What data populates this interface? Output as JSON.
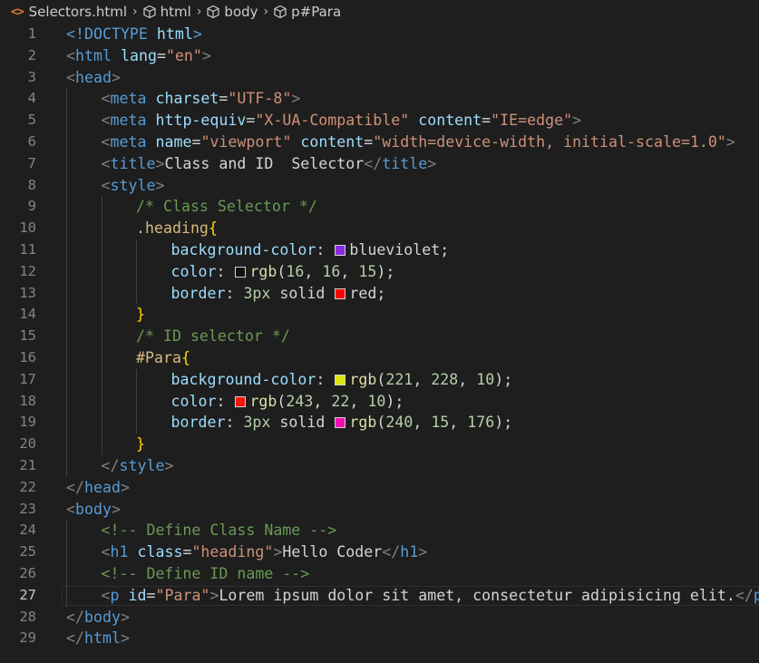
{
  "breadcrumb": {
    "file_icon": "<>",
    "file": "Selectors.html",
    "items": [
      "html",
      "body",
      "p#Para"
    ]
  },
  "editor": {
    "active_line": 27,
    "line_numbers": [
      "1",
      "2",
      "3",
      "4",
      "5",
      "6",
      "7",
      "8",
      "9",
      "10",
      "11",
      "12",
      "13",
      "14",
      "15",
      "16",
      "17",
      "18",
      "19",
      "20",
      "21",
      "22",
      "23",
      "24",
      "25",
      "26",
      "27",
      "28",
      "29"
    ],
    "lines": [
      {
        "indent": 0,
        "tokens": [
          [
            "t-tag",
            "<!DOCTYPE"
          ],
          [
            "t-text",
            " "
          ],
          [
            "t-attr",
            "html"
          ],
          [
            "t-tag",
            ">"
          ]
        ]
      },
      {
        "indent": 0,
        "tokens": [
          [
            "t-punc",
            "<"
          ],
          [
            "t-tag",
            "html"
          ],
          [
            "t-text",
            " "
          ],
          [
            "t-attr",
            "lang"
          ],
          [
            "t-text",
            "="
          ],
          [
            "t-str",
            "\"en\""
          ],
          [
            "t-punc",
            ">"
          ]
        ]
      },
      {
        "indent": 0,
        "tokens": [
          [
            "t-punc",
            "<"
          ],
          [
            "t-tag",
            "head"
          ],
          [
            "t-punc",
            ">"
          ]
        ]
      },
      {
        "indent": 1,
        "tokens": [
          [
            "t-punc",
            "<"
          ],
          [
            "t-tag",
            "meta"
          ],
          [
            "t-text",
            " "
          ],
          [
            "t-attr",
            "charset"
          ],
          [
            "t-text",
            "="
          ],
          [
            "t-str",
            "\"UTF-8\""
          ],
          [
            "t-punc",
            ">"
          ]
        ]
      },
      {
        "indent": 1,
        "tokens": [
          [
            "t-punc",
            "<"
          ],
          [
            "t-tag",
            "meta"
          ],
          [
            "t-text",
            " "
          ],
          [
            "t-attr",
            "http-equiv"
          ],
          [
            "t-text",
            "="
          ],
          [
            "t-str",
            "\"X-UA-Compatible\""
          ],
          [
            "t-text",
            " "
          ],
          [
            "t-attr",
            "content"
          ],
          [
            "t-text",
            "="
          ],
          [
            "t-str",
            "\"IE=edge\""
          ],
          [
            "t-punc",
            ">"
          ]
        ]
      },
      {
        "indent": 1,
        "tokens": [
          [
            "t-punc",
            "<"
          ],
          [
            "t-tag",
            "meta"
          ],
          [
            "t-text",
            " "
          ],
          [
            "t-attr",
            "name"
          ],
          [
            "t-text",
            "="
          ],
          [
            "t-str",
            "\"viewport\""
          ],
          [
            "t-text",
            " "
          ],
          [
            "t-attr",
            "content"
          ],
          [
            "t-text",
            "="
          ],
          [
            "t-str",
            "\"width=device-width, initial-scale=1.0\""
          ],
          [
            "t-punc",
            ">"
          ]
        ]
      },
      {
        "indent": 1,
        "tokens": [
          [
            "t-punc",
            "<"
          ],
          [
            "t-tag",
            "title"
          ],
          [
            "t-punc",
            ">"
          ],
          [
            "t-text",
            "Class and ID  Selector"
          ],
          [
            "t-punc",
            "</"
          ],
          [
            "t-tag",
            "title"
          ],
          [
            "t-punc",
            ">"
          ]
        ]
      },
      {
        "indent": 1,
        "tokens": [
          [
            "t-punc",
            "<"
          ],
          [
            "t-tag",
            "style"
          ],
          [
            "t-punc",
            ">"
          ]
        ]
      },
      {
        "indent": 2,
        "tokens": [
          [
            "t-comment",
            "/* Class Selector */"
          ]
        ]
      },
      {
        "indent": 2,
        "tokens": [
          [
            "t-sel",
            ".heading"
          ],
          [
            "t-brace",
            "{"
          ]
        ]
      },
      {
        "indent": 3,
        "tokens": [
          [
            "t-prop",
            "background-color"
          ],
          [
            "t-text",
            ": "
          ],
          [
            "swatch",
            "#8a2be2"
          ],
          [
            "t-text",
            "blueviolet;"
          ]
        ]
      },
      {
        "indent": 3,
        "tokens": [
          [
            "t-prop",
            "color"
          ],
          [
            "t-text",
            ": "
          ],
          [
            "swatch",
            "#10100f"
          ],
          [
            "t-fn",
            "rgb"
          ],
          [
            "t-text",
            "("
          ],
          [
            "t-num",
            "16"
          ],
          [
            "t-text",
            ", "
          ],
          [
            "t-num",
            "16"
          ],
          [
            "t-text",
            ", "
          ],
          [
            "t-num",
            "15"
          ],
          [
            "t-text",
            ");"
          ]
        ]
      },
      {
        "indent": 3,
        "tokens": [
          [
            "t-prop",
            "border"
          ],
          [
            "t-text",
            ": "
          ],
          [
            "t-num",
            "3px"
          ],
          [
            "t-text",
            " solid "
          ],
          [
            "swatch",
            "#ff0000"
          ],
          [
            "t-text",
            "red;"
          ]
        ]
      },
      {
        "indent": 2,
        "tokens": [
          [
            "t-brace",
            "}"
          ]
        ]
      },
      {
        "indent": 2,
        "tokens": [
          [
            "t-comment",
            "/* ID selector */"
          ]
        ]
      },
      {
        "indent": 2,
        "tokens": [
          [
            "t-sel",
            "#Para"
          ],
          [
            "t-brace",
            "{"
          ]
        ]
      },
      {
        "indent": 3,
        "tokens": [
          [
            "t-prop",
            "background-color"
          ],
          [
            "t-text",
            ": "
          ],
          [
            "swatch",
            "#dde40a"
          ],
          [
            "t-fn",
            "rgb"
          ],
          [
            "t-text",
            "("
          ],
          [
            "t-num",
            "221"
          ],
          [
            "t-text",
            ", "
          ],
          [
            "t-num",
            "228"
          ],
          [
            "t-text",
            ", "
          ],
          [
            "t-num",
            "10"
          ],
          [
            "t-text",
            ");"
          ]
        ]
      },
      {
        "indent": 3,
        "tokens": [
          [
            "t-prop",
            "color"
          ],
          [
            "t-text",
            ": "
          ],
          [
            "swatch",
            "#f3160a"
          ],
          [
            "t-fn",
            "rgb"
          ],
          [
            "t-text",
            "("
          ],
          [
            "t-num",
            "243"
          ],
          [
            "t-text",
            ", "
          ],
          [
            "t-num",
            "22"
          ],
          [
            "t-text",
            ", "
          ],
          [
            "t-num",
            "10"
          ],
          [
            "t-text",
            ");"
          ]
        ]
      },
      {
        "indent": 3,
        "tokens": [
          [
            "t-prop",
            "border"
          ],
          [
            "t-text",
            ": "
          ],
          [
            "t-num",
            "3px"
          ],
          [
            "t-text",
            " solid "
          ],
          [
            "swatch",
            "#f00fb0"
          ],
          [
            "t-fn",
            "rgb"
          ],
          [
            "t-text",
            "("
          ],
          [
            "t-num",
            "240"
          ],
          [
            "t-text",
            ", "
          ],
          [
            "t-num",
            "15"
          ],
          [
            "t-text",
            ", "
          ],
          [
            "t-num",
            "176"
          ],
          [
            "t-text",
            ");"
          ]
        ]
      },
      {
        "indent": 2,
        "tokens": [
          [
            "t-brace",
            "}"
          ]
        ]
      },
      {
        "indent": 1,
        "tokens": [
          [
            "t-punc",
            "</"
          ],
          [
            "t-tag",
            "style"
          ],
          [
            "t-punc",
            ">"
          ]
        ]
      },
      {
        "indent": 0,
        "tokens": [
          [
            "t-punc",
            "</"
          ],
          [
            "t-tag",
            "head"
          ],
          [
            "t-punc",
            ">"
          ]
        ]
      },
      {
        "indent": 0,
        "tokens": [
          [
            "t-punc",
            "<"
          ],
          [
            "t-tag",
            "body"
          ],
          [
            "t-punc",
            ">"
          ]
        ]
      },
      {
        "indent": 1,
        "tokens": [
          [
            "t-comment",
            "<!-- Define Class Name -->"
          ]
        ]
      },
      {
        "indent": 1,
        "tokens": [
          [
            "t-punc",
            "<"
          ],
          [
            "t-tag",
            "h1"
          ],
          [
            "t-text",
            " "
          ],
          [
            "t-attr",
            "class"
          ],
          [
            "t-text",
            "="
          ],
          [
            "t-str",
            "\"heading\""
          ],
          [
            "t-punc",
            ">"
          ],
          [
            "t-text",
            "Hello Coder"
          ],
          [
            "t-punc",
            "</"
          ],
          [
            "t-tag",
            "h1"
          ],
          [
            "t-punc",
            ">"
          ]
        ]
      },
      {
        "indent": 1,
        "tokens": [
          [
            "t-comment",
            "<!-- Define ID name -->"
          ]
        ]
      },
      {
        "indent": 1,
        "tokens": [
          [
            "t-punc",
            "<"
          ],
          [
            "t-tag",
            "p"
          ],
          [
            "t-text",
            " "
          ],
          [
            "t-attr",
            "id"
          ],
          [
            "t-text",
            "="
          ],
          [
            "t-str",
            "\"Para\""
          ],
          [
            "t-punc",
            ">"
          ],
          [
            "t-text",
            "Lorem ipsum dolor sit amet, consectetur adipisicing elit."
          ],
          [
            "t-punc",
            "</"
          ],
          [
            "t-tag",
            "p"
          ],
          [
            "t-punc",
            ">"
          ]
        ]
      },
      {
        "indent": 0,
        "tokens": [
          [
            "t-punc",
            "</"
          ],
          [
            "t-tag",
            "body"
          ],
          [
            "t-punc",
            ">"
          ]
        ]
      },
      {
        "indent": 0,
        "tokens": [
          [
            "t-punc",
            "</"
          ],
          [
            "t-tag",
            "html"
          ],
          [
            "t-punc",
            ">"
          ]
        ]
      }
    ]
  }
}
